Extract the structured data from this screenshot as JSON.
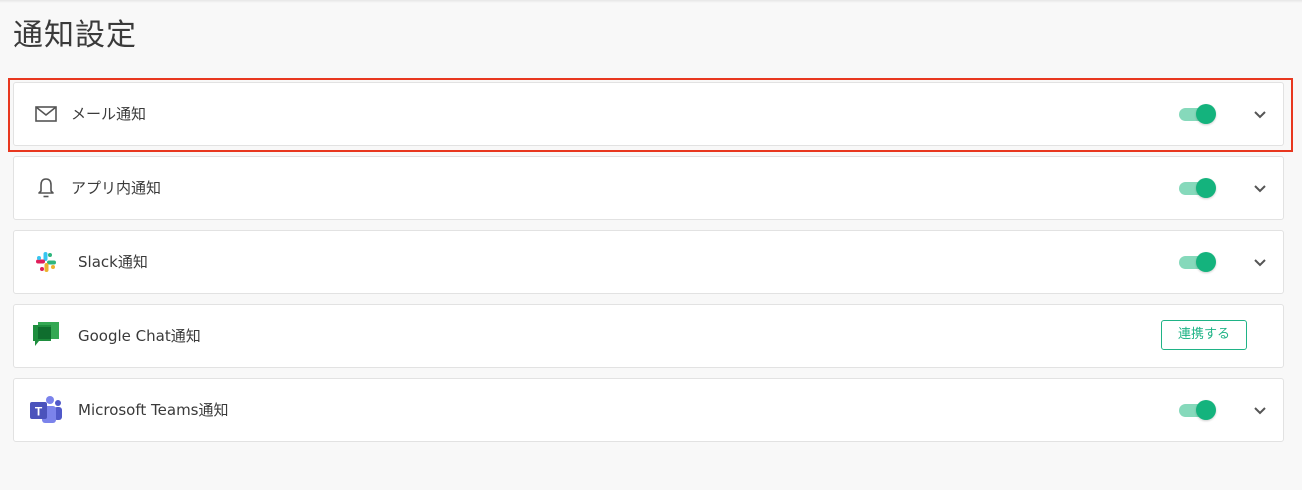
{
  "page": {
    "title": "通知設定"
  },
  "channels": [
    {
      "icon": "mail-icon",
      "label": "メール通知",
      "enabled": true,
      "control": "toggle"
    },
    {
      "icon": "bell-icon",
      "label": "アプリ内通知",
      "enabled": true,
      "control": "toggle"
    },
    {
      "icon": "slack-icon",
      "label": "Slack通知",
      "enabled": true,
      "control": "toggle"
    },
    {
      "icon": "google-chat-icon",
      "label": "Google Chat通知",
      "control": "button",
      "button_label": "連携する"
    },
    {
      "icon": "microsoft-teams-icon",
      "label": "Microsoft Teams通知",
      "enabled": true,
      "control": "toggle"
    }
  ],
  "colors": {
    "toggle_on_track": "#86d9bb",
    "toggle_on_knob": "#14b37d",
    "link_button": "#1fb386",
    "highlight": "#e8371f"
  }
}
